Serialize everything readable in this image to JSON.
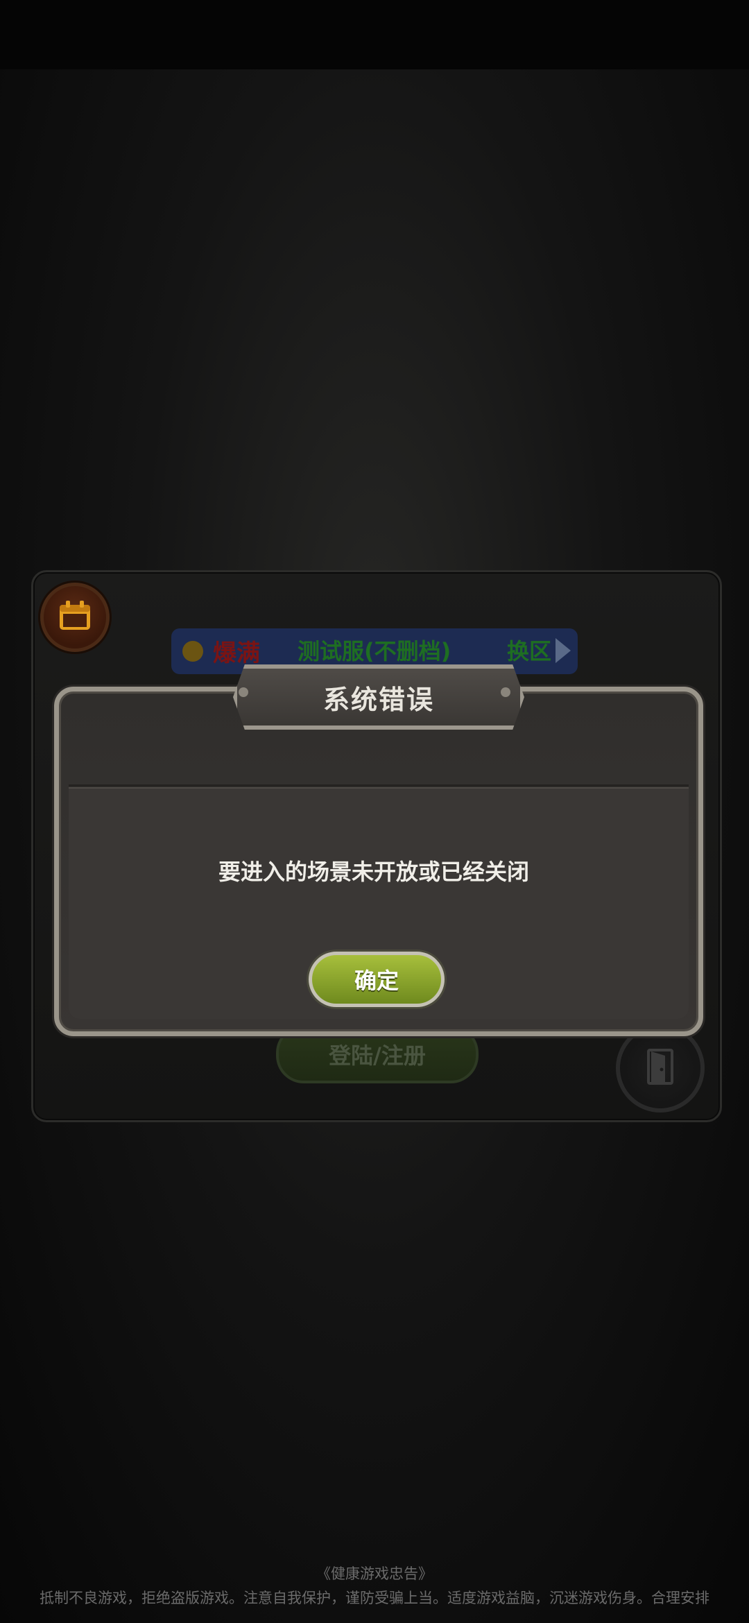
{
  "server": {
    "status": "爆满",
    "name": "测试服(不删档)",
    "switch_label": "换区"
  },
  "login": {
    "button_label": "登陆/注册"
  },
  "dialog": {
    "title": "系统错误",
    "message": "要进入的场景未开放或已经关闭",
    "ok_label": "确定"
  },
  "notice": {
    "title": "《健康游戏忠告》",
    "text": "抵制不良游戏，拒绝盗版游戏。注意自我保护，谨防受骗上当。适度游戏益脑，沉迷游戏伤身。合理安排"
  },
  "colors": {
    "server_status": "#7a1414",
    "server_name": "#1e6e22",
    "ok_button": "#8fa72e"
  },
  "icons": [
    "calendar-icon",
    "arrow-right-icon",
    "exit-door-icon"
  ]
}
